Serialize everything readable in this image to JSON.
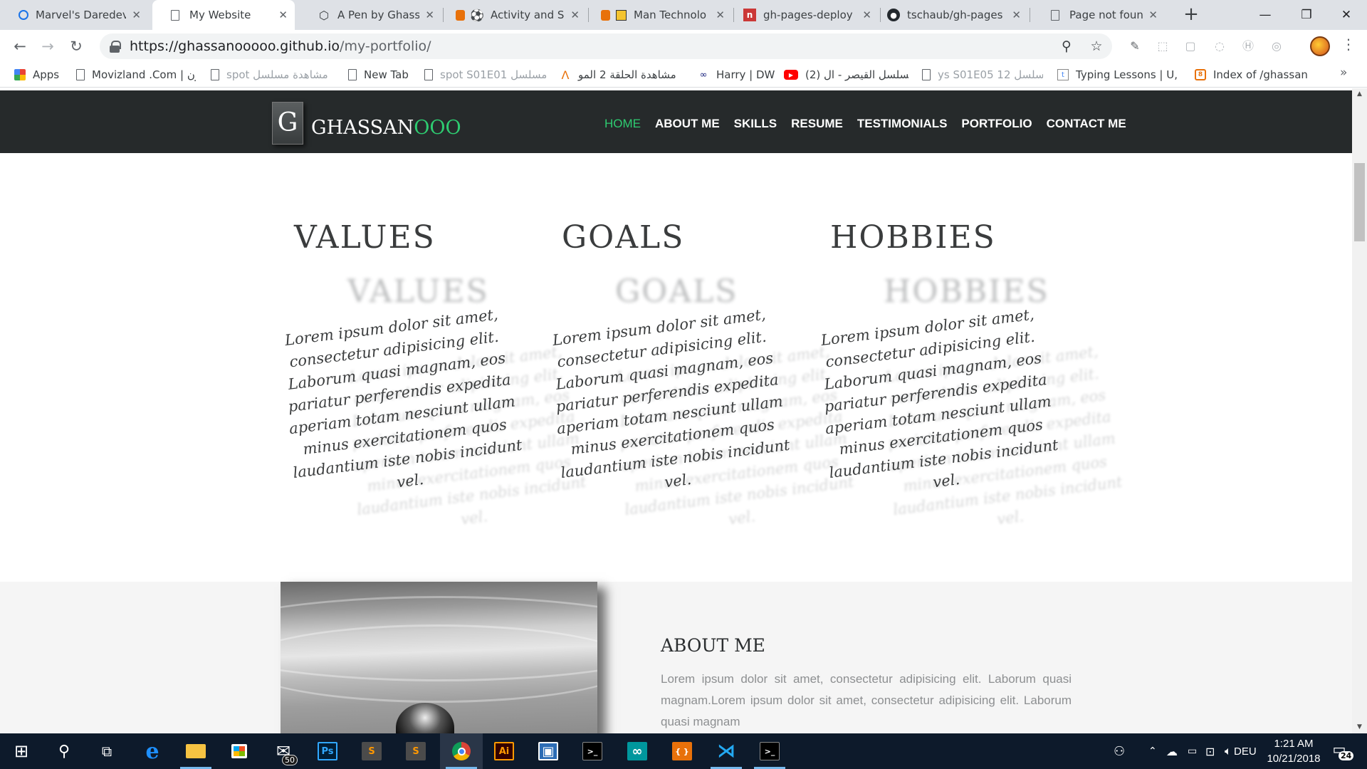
{
  "browser": {
    "tabs": [
      {
        "title": "Marvel's Daredevil",
        "icon": "circle-favicon-icon",
        "active": false
      },
      {
        "title": "My Website",
        "icon": "page-icon",
        "active": true
      },
      {
        "title": "A Pen by Ghassan",
        "icon": "codepen-icon",
        "active": false
      },
      {
        "title": "Activity and Sp",
        "icon": "soccer-ball-icon",
        "active": false
      },
      {
        "title": "Man Technolo",
        "icon": "app-icon",
        "active": false
      },
      {
        "title": "gh-pages-deploy",
        "icon": "npm-icon",
        "active": false
      },
      {
        "title": "tschaub/gh-pages",
        "icon": "github-icon",
        "active": false
      },
      {
        "title": "Page not found · G",
        "icon": "page-icon",
        "active": false
      }
    ],
    "tab_close_glyph": "✕",
    "new_tab_glyph": "+",
    "window_controls": {
      "minimize": "—",
      "restore": "❐",
      "close": "✕"
    },
    "nav": {
      "back": "←",
      "forward": "→",
      "reload": "↻"
    },
    "url": {
      "host": "https://ghassanooooo.github.io",
      "path": "/my-portfolio/"
    },
    "omnibox_icons": {
      "zoom": "⚲",
      "star": "☆"
    },
    "extension_icons": [
      "✎",
      "⬚",
      "▢",
      "◌",
      "Ⓗ",
      "◎"
    ],
    "menu_glyph": "⋮",
    "bookmarks": [
      {
        "label": "Apps",
        "icon": "apps-grid-icon"
      },
      {
        "label": "Movizland .Com | ون",
        "icon": "page-icon"
      },
      {
        "label": "spot مشاهدة مسلسل",
        "icon": "page-icon"
      },
      {
        "label": "New Tab",
        "icon": "page-icon"
      },
      {
        "label": "spot S01E01 مسلسل",
        "icon": "page-icon"
      },
      {
        "label": "مشاهدة الحلقة 2 المو",
        "icon": "a-logo-icon"
      },
      {
        "label": "Harry | DW",
        "icon": "goggles-icon"
      },
      {
        "label": "(2) مسلسل القيصر - ال",
        "icon": "youtube-icon"
      },
      {
        "label": "ys S01E05 12 مسلسل",
        "icon": "page-icon"
      },
      {
        "label": "Typing Lessons | U, R",
        "icon": "typing-icon"
      },
      {
        "label": "Index of /ghassan",
        "icon": "index-icon"
      }
    ],
    "bookmarks_more": "»"
  },
  "site": {
    "logo_letter": "G",
    "logo_text_a": "GHASSAN",
    "logo_text_b": "OOO",
    "nav": [
      "HOME",
      "ABOUT ME",
      "SKILLS",
      "RESUME",
      "TESTIMONIALS",
      "PORTFOLIO",
      "CONTACT ME"
    ],
    "accent_color": "#2ecc71",
    "nav_bg": "#262a2b",
    "columns": [
      {
        "title": "VALUES",
        "text": "Lorem ipsum dolor sit amet, consectetur adipisicing elit. Laborum quasi magnam, eos pariatur perferendis expedita aperiam totam nesciunt ullam minus exercitationem quos laudantium iste nobis incidunt vel."
      },
      {
        "title": "GOALS",
        "text": "Lorem ipsum dolor sit amet, consectetur adipisicing elit. Laborum quasi magnam, eos pariatur perferendis expedita aperiam totam nesciunt ullam minus exercitationem quos laudantium iste nobis incidunt vel."
      },
      {
        "title": "HOBBIES",
        "text": "Lorem ipsum dolor sit amet, consectetur adipisicing elit. Laborum quasi magnam, eos pariatur perferendis expedita aperiam totam nesciunt ullam minus exercitationem quos laudantium iste nobis incidunt vel."
      }
    ],
    "about": {
      "title": "ABOUT ME",
      "text": "Lorem ipsum dolor sit amet, consectetur adipisicing elit. Laborum quasi magnam.Lorem ipsum dolor sit amet, consectetur adipisicing elit. Laborum quasi magnam"
    }
  },
  "taskbar": {
    "apps": [
      {
        "name": "start-icon",
        "glyph": "⊞"
      },
      {
        "name": "search-icon",
        "glyph": "⚲"
      },
      {
        "name": "task-view-icon",
        "glyph": "⧉"
      },
      {
        "name": "edge-icon",
        "glyph": "e"
      },
      {
        "name": "file-explorer-icon",
        "glyph": "▬"
      },
      {
        "name": "store-icon",
        "glyph": "▦"
      },
      {
        "name": "mail-icon",
        "glyph": "✉"
      },
      {
        "name": "photoshop-icon",
        "glyph": "Ps"
      },
      {
        "name": "sublime-merge-icon",
        "glyph": "S"
      },
      {
        "name": "sublime-text-icon",
        "glyph": "S"
      },
      {
        "name": "chrome-icon",
        "glyph": "◉"
      },
      {
        "name": "illustrator-icon",
        "glyph": "Ai"
      },
      {
        "name": "jet-app-icon",
        "glyph": "▣"
      },
      {
        "name": "terminal-icon",
        "glyph": ">_"
      },
      {
        "name": "arduino-icon",
        "glyph": "∞"
      },
      {
        "name": "brackets-icon",
        "glyph": "{ }"
      },
      {
        "name": "vscode-icon",
        "glyph": "⋊"
      },
      {
        "name": "console-icon",
        "glyph": ">_"
      }
    ],
    "mail_badge": "50",
    "tray_language": "DEU",
    "time": "1:21 AM",
    "date": "10/21/2018",
    "notifications_count": "24"
  }
}
